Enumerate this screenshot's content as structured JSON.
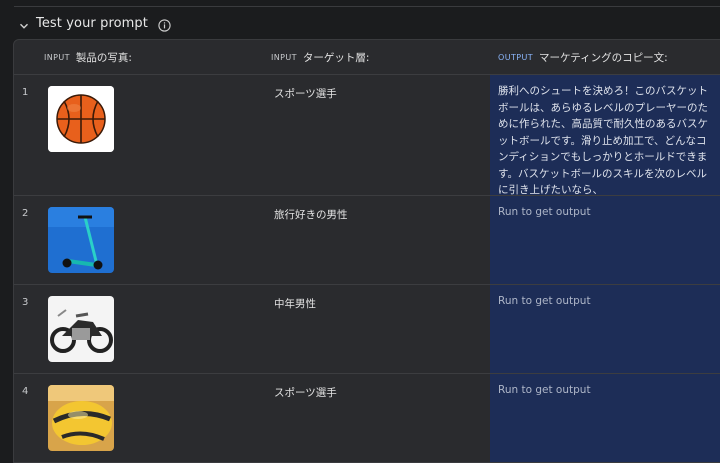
{
  "section": {
    "title": "Test your prompt",
    "chevron_icon": "chevron-down-icon",
    "info_icon": "info-icon"
  },
  "columns": [
    {
      "tag": "INPUT",
      "label": "製品の写真:"
    },
    {
      "tag": "INPUT",
      "label": "ターゲット層:"
    },
    {
      "tag": "OUTPUT",
      "label": "マーケティングのコピー文:"
    }
  ],
  "rows": [
    {
      "num": "1",
      "image": "basketball",
      "target": "スポーツ選手",
      "output": "勝利へのシュートを決めろ！このバスケットボールは、あらゆるレベルのプレーヤーのために作られた、高品質で耐久性のあるバスケットボールです。滑り止め加工で、どんなコンディションでもしっかりとホールドできます。バスケットボールのスキルを次のレベルに引き上げたいなら、"
    },
    {
      "num": "2",
      "image": "scooter",
      "target": "旅行好きの男性",
      "output": "Run to get output"
    },
    {
      "num": "3",
      "image": "motorcycle",
      "target": "中年男性",
      "output": "Run to get output"
    },
    {
      "num": "4",
      "image": "volleyball",
      "target": "スポーツ選手",
      "output": "Run to get output"
    }
  ],
  "colors": {
    "output_column": "#1d2d57",
    "output_tag": "#8ab4f8"
  }
}
